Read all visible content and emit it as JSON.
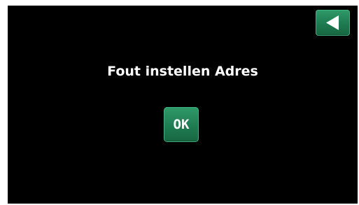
{
  "dialog": {
    "message": "Fout instellen Adres",
    "ok_label": "OK"
  },
  "nav": {
    "back_icon": "back-arrow-icon"
  },
  "colors": {
    "background": "#000000",
    "button": "#1f7c52",
    "text": "#ffffff"
  }
}
